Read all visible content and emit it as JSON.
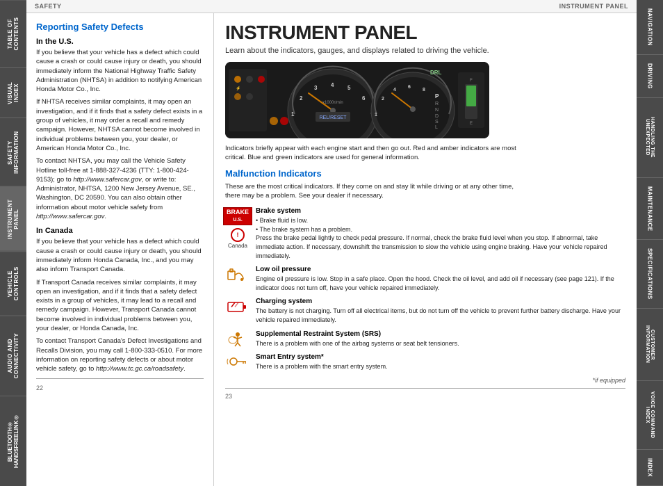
{
  "topbar": {
    "left": "SAFETY",
    "right": "INSTRUMENT PANEL"
  },
  "left_sidebar_tabs": [
    {
      "label": "TABLE OF CONTENTS",
      "active": false
    },
    {
      "label": "VISUAL INDEX",
      "active": false
    },
    {
      "label": "SAFETY INFORMATION",
      "active": false
    },
    {
      "label": "INSTRUMENT PANEL",
      "active": true
    },
    {
      "label": "VEHICLE CONTROLS",
      "active": false
    },
    {
      "label": "AUDIO AND CONNECTIVITY",
      "active": false
    },
    {
      "label": "BLUETOOTH® HANDSFREELINK®",
      "active": false
    }
  ],
  "right_sidebar_tabs": [
    {
      "label": "NAVIGATION",
      "active": false
    },
    {
      "label": "DRIVING",
      "active": false
    },
    {
      "label": "HANDLING THE UNEXPECTED",
      "active": false
    },
    {
      "label": "MAINTENANCE",
      "active": false
    },
    {
      "label": "SPECIFICATIONS",
      "active": false
    },
    {
      "label": "CUSTOMER INFORMATION",
      "active": false
    },
    {
      "label": "VOICE COMMAND INDEX",
      "active": false
    },
    {
      "label": "INDEX",
      "active": false
    }
  ],
  "left_page": {
    "title": "Reporting Safety Defects",
    "us_heading": "In the U.S.",
    "us_paragraphs": [
      "If you believe that your vehicle has a defect which could cause a crash or could cause injury or death, you should immediately inform the National Highway Traffic Safety Administration (NHTSA) in addition to notifying American Honda Motor Co., Inc.",
      "If NHTSA receives similar complaints, it may open an investigation, and if it finds that a safety defect exists in a group of vehicles, it may order a recall and remedy campaign. However, NHTSA cannot become involved in individual problems between you, your dealer, or American Honda Motor Co., Inc.",
      "To contact NHTSA, you may call the Vehicle Safety Hotline toll-free at 1-888-327-4236 (TTY: 1-800-424-9153); go to http://www.safercar.gov, or write to: Administrator, NHTSA, 1200 New Jersey Avenue, SE., Washington, DC 20590. You can also obtain other information about motor vehicle safety from http://www.safercar.gov."
    ],
    "canada_heading": "In Canada",
    "canada_paragraphs": [
      "If you believe that your vehicle has a defect which could cause a crash or could cause injury or death, you should immediately inform Honda Canada, Inc., and you may also inform Transport Canada.",
      "If Transport Canada receives similar complaints, it may open an investigation, and if it finds that a safety defect exists in a group of vehicles, it may lead to a recall and remedy campaign. However, Transport Canada cannot become involved in individual problems between you, your dealer, or Honda Canada, Inc.",
      "To contact Transport Canada's Defect Investigations and Recalls Division, you may call 1-800-333-0510. For more information on reporting safety defects or about motor vehicle safety, go to http://www.tc.gc.ca/roadsafety."
    ],
    "page_number": "22"
  },
  "right_page": {
    "title": "INSTRUMENT PANEL",
    "subtitle": "Learn about the indicators, gauges, and displays related to driving the vehicle.",
    "indicators_caption": "Indicators briefly appear with each engine start and then go out. Red and amber indicators are most critical. Blue and green indicators are used for general information.",
    "malfunction_heading": "Malfunction Indicators",
    "malfunction_intro": "These are the most critical indicators. If they come on and stay lit while driving or at any other time, there may be a problem. See your dealer if necessary.",
    "indicators": [
      {
        "icon_type": "brake",
        "icon_label_top": "BRAKE",
        "icon_label_bot": "U.S.",
        "icon_label_canada": "Canada",
        "title": "Brake system",
        "lines": [
          "• Brake fluid is low.",
          "• The brake system has a problem.",
          "Press the brake pedal lightly to check pedal pressure. If normal, check the brake fluid level when you stop. If abnormal, take immediate action. If necessary, downshift the transmission to slow the vehicle using engine braking. Have your vehicle repaired immediately."
        ]
      },
      {
        "icon_type": "oil",
        "title": "Low oil pressure",
        "lines": [
          "Engine oil pressure is low. Stop in a safe place. Open the hood. Check the oil level, and add oil if necessary (see page 121). If the indicator does not turn off, have your vehicle repaired immediately."
        ]
      },
      {
        "icon_type": "battery",
        "title": "Charging system",
        "lines": [
          "The battery is not charging. Turn off all electrical items, but do not turn off the vehicle to prevent further battery discharge. Have your vehicle repaired immediately."
        ]
      },
      {
        "icon_type": "srs",
        "title": "Supplemental Restraint System (SRS)",
        "lines": [
          "There is a problem with one of the airbag systems or seat belt tensioners."
        ]
      },
      {
        "icon_type": "key",
        "title": "Smart Entry system*",
        "lines": [
          "There is a problem with the smart entry system."
        ]
      }
    ],
    "equipped_note": "*if equipped",
    "page_number": "23"
  }
}
